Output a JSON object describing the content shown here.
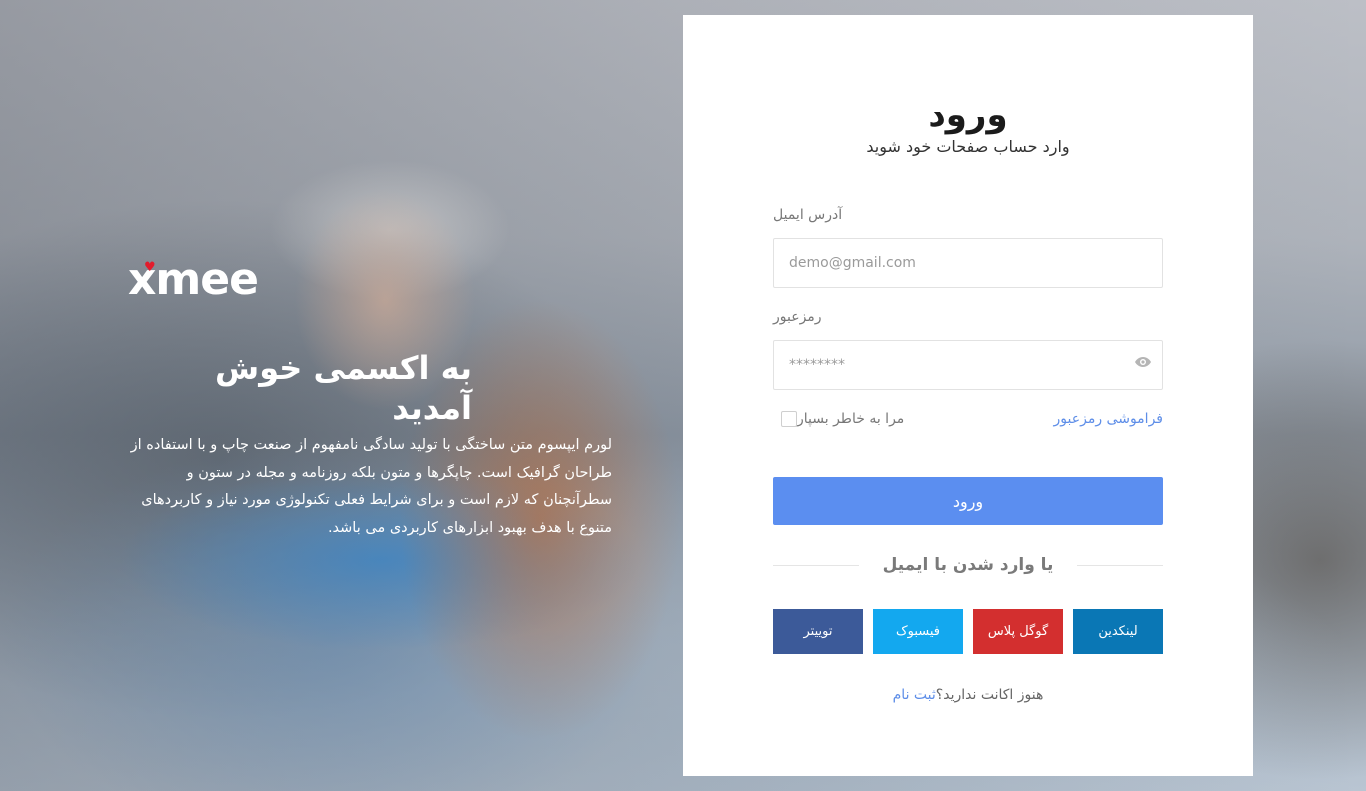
{
  "colors": {
    "primary": "#5b8ef0",
    "link": "#5e8ee8",
    "logo_heart": "#e21b2c",
    "linkedin": "#0a77b5",
    "googleplus": "#d32f2f",
    "facebook": "#13a8ef",
    "twitter": "#3c5a99"
  },
  "hero": {
    "logo": "xmee",
    "title": "به اکسمی خوش آمدید",
    "text": "لورم ایپسوم متن ساختگی با تولید سادگی نامفهوم از صنعت چاپ و با استفاده از طراحان گرافیک است. چاپگرها و متون بلکه روزنامه و مجله در ستون و سطرآنچنان که لازم است و برای شرایط فعلی تکنولوژی مورد نیاز و کاربردهای متنوع با هدف بهبود ابزارهای کاربردی می باشد."
  },
  "login": {
    "title": "ورود",
    "subtitle": "وارد حساب صفحات خود شوید",
    "email": {
      "label": "آدرس ایمیل",
      "placeholder": "demo@gmail.com"
    },
    "password": {
      "label": "رمزعبور",
      "placeholder": "********"
    },
    "remember_label": "مرا به خاطر بسپار",
    "forgot_label": "فراموشی رمزعبور",
    "submit_label": "ورود",
    "divider_text": "یا وارد شدن با ایمیل",
    "social": {
      "linkedin": "لینکدین",
      "googleplus": "گوگل پلاس",
      "facebook": "فیسبوک",
      "twitter": "توییتر"
    },
    "signup": {
      "prompt": "هنوز اکانت ندارید؟",
      "link": "ثبت نام"
    }
  },
  "icons": {
    "password_toggle": "eye-icon",
    "logo_mark": "heart-icon"
  }
}
